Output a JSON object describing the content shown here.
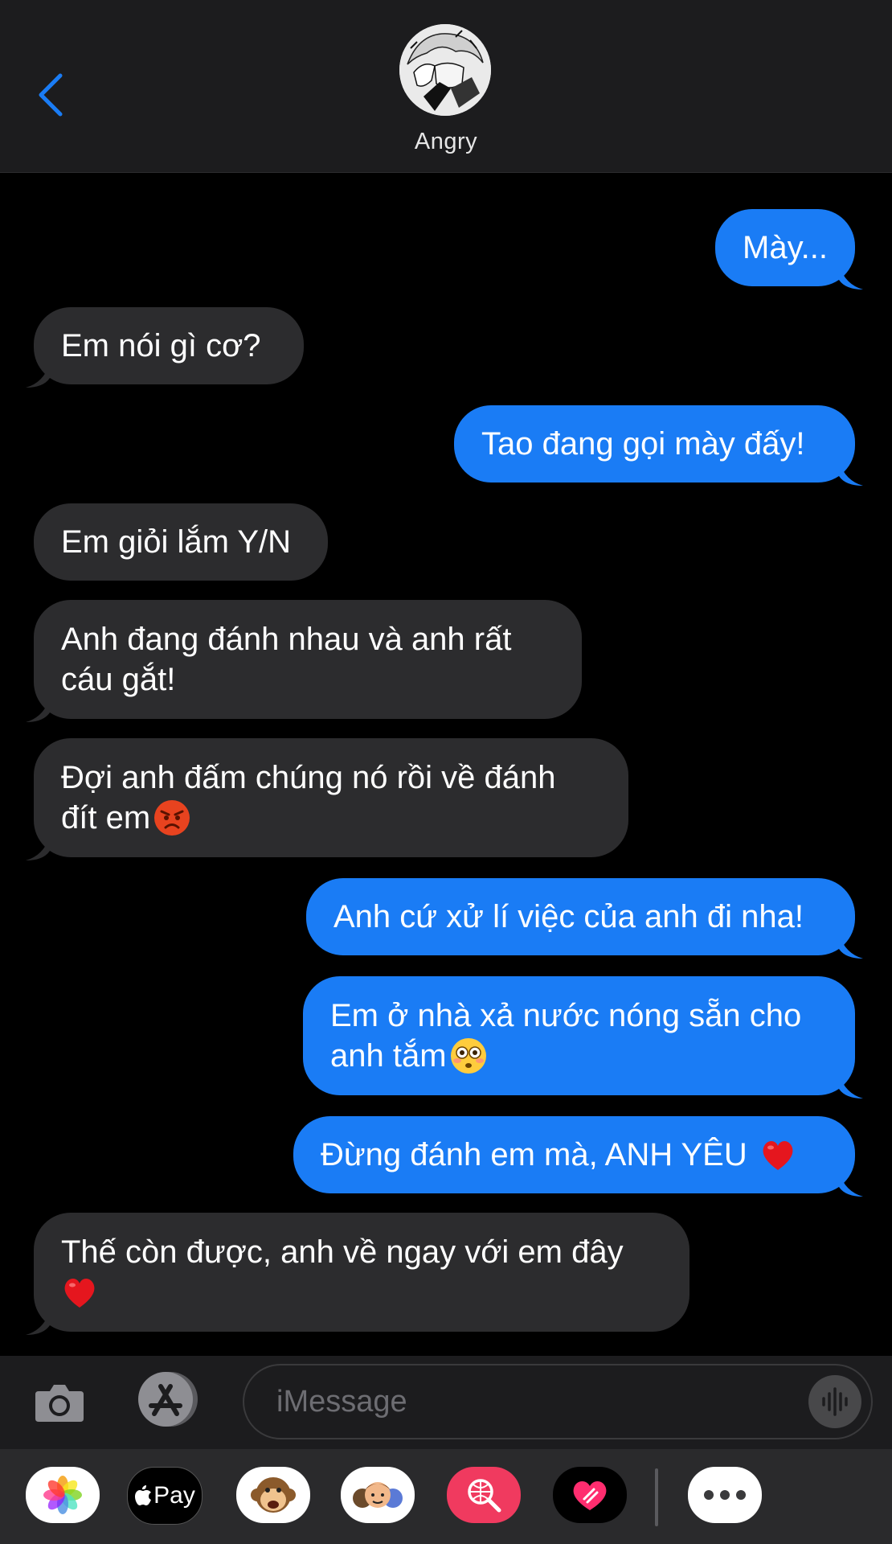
{
  "header": {
    "contact_name": "Angry"
  },
  "messages": [
    {
      "side": "sent",
      "text": "Mày..."
    },
    {
      "side": "received",
      "text": "Em nói gì cơ?"
    },
    {
      "side": "sent",
      "text": "Tao đang gọi mày đấy!"
    },
    {
      "side": "received",
      "text": "Em giỏi lắm Y/N"
    },
    {
      "side": "received",
      "text": "Anh đang đánh nhau và anh rất\ncáu gắt!"
    },
    {
      "side": "received",
      "text": "Đợi anh đấm chúng nó rồi về đánh\nđít em",
      "emoji": "angry-face"
    },
    {
      "side": "sent",
      "text": "Anh cứ xử lí việc của anh đi nha!"
    },
    {
      "side": "sent",
      "text": "Em ở nhà xả nước nóng sẵn cho\nanh tắm",
      "emoji": "flushed-face"
    },
    {
      "side": "sent",
      "text": "Đừng đánh em mà, ANH YÊU ",
      "emoji": "red-heart"
    },
    {
      "side": "received",
      "text": "Thế còn được, anh về ngay với em đây\n",
      "emoji": "red-heart"
    }
  ],
  "input": {
    "placeholder": "iMessage"
  },
  "apps": {
    "apple_pay_label": "Pay",
    "items": [
      "photos",
      "apple-pay",
      "animoji",
      "memoji",
      "images-search",
      "digital-touch",
      "more"
    ]
  },
  "colors": {
    "sent": "#1a7cf5",
    "received": "#2c2c2e",
    "background": "#000000",
    "accent": "#1a7cf5"
  }
}
